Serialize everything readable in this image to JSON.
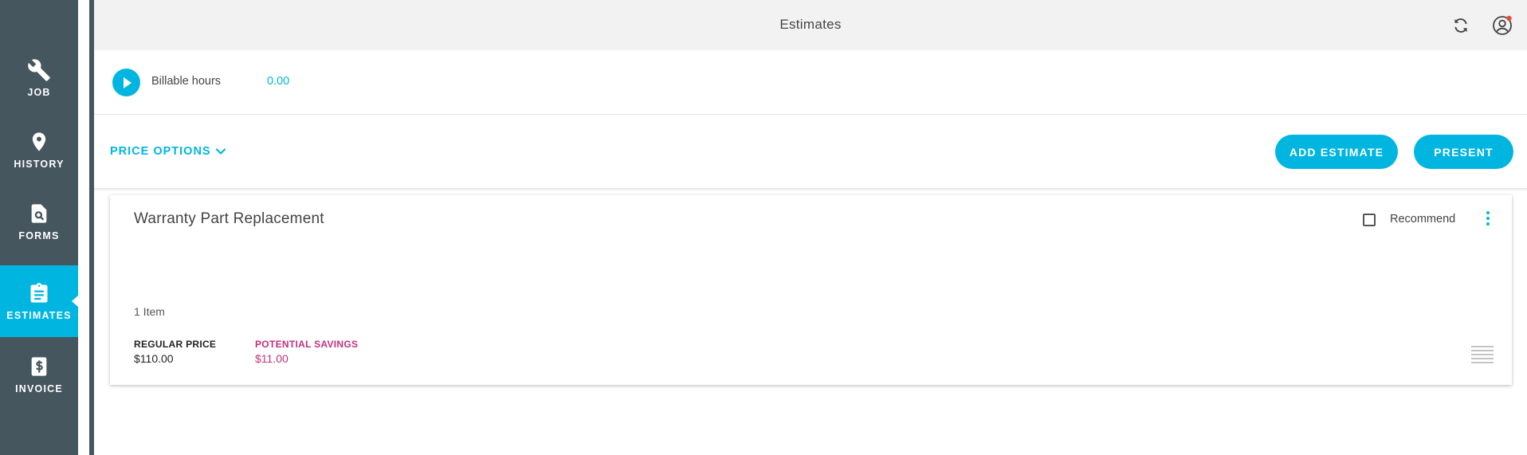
{
  "sidebar": {
    "items": [
      {
        "label": "JOB",
        "icon": "wrench-icon",
        "active": false
      },
      {
        "label": "HISTORY",
        "icon": "map-pin-icon",
        "active": false
      },
      {
        "label": "FORMS",
        "icon": "document-search-icon",
        "active": false
      },
      {
        "label": "ESTIMATES",
        "icon": "clipboard-icon",
        "active": true
      },
      {
        "label": "INVOICE",
        "icon": "invoice-dollar-icon",
        "active": false
      }
    ]
  },
  "header": {
    "title": "Estimates",
    "sync_icon": "sync-icon",
    "user_icon": "user-account-icon"
  },
  "billable": {
    "label": "Billable hours",
    "value": "0.00"
  },
  "toolbar": {
    "price_options_label": "PRICE OPTIONS",
    "add_estimate_label": "ADD ESTIMATE",
    "present_label": "PRESENT"
  },
  "estimate_card": {
    "title": "Warranty Part Replacement",
    "recommend_label": "Recommend",
    "recommend_checked": false,
    "item_count": "1 Item",
    "regular_price_label": "REGULAR PRICE",
    "regular_price_value": "$110.00",
    "potential_savings_label": "POTENTIAL SAVINGS",
    "potential_savings_value": "$11.00"
  },
  "colors": {
    "accent": "#00b6e0",
    "sidebar": "#46565f",
    "savings": "#c4307a",
    "notification": "#e94b3c"
  }
}
